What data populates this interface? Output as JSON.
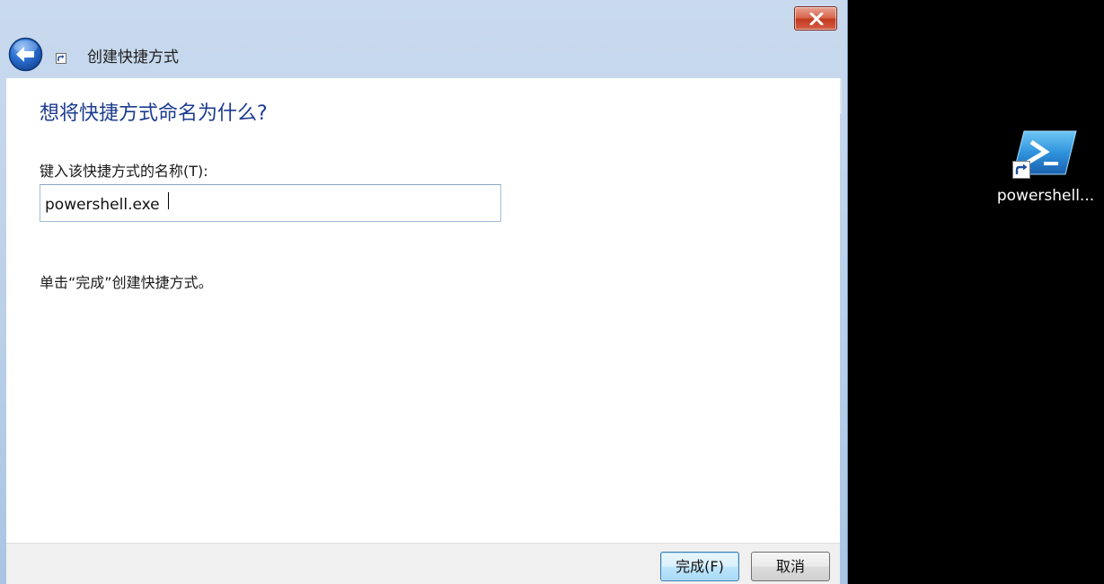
{
  "dialog": {
    "title": "创建快捷方式",
    "question": "想将快捷方式命名为什么?",
    "name_label": "键入该快捷方式的名称(T):",
    "name_value": "powershell.exe",
    "finish_hint": "单击“完成”创建快捷方式。",
    "buttons": {
      "finish": "完成(F)",
      "cancel": "取消"
    },
    "icons": {
      "back": "back-arrow-icon",
      "close": "close-x-icon",
      "header": "shortcut-icon"
    },
    "colors": {
      "question_text": "#1c3c8e",
      "chrome": "#b9cfe8",
      "close_button": "#c2391d",
      "back_button": "#2a6fd0"
    }
  },
  "desktop": {
    "shortcut_label": "powershell...",
    "icon": "powershell-icon",
    "background": "#000000"
  }
}
